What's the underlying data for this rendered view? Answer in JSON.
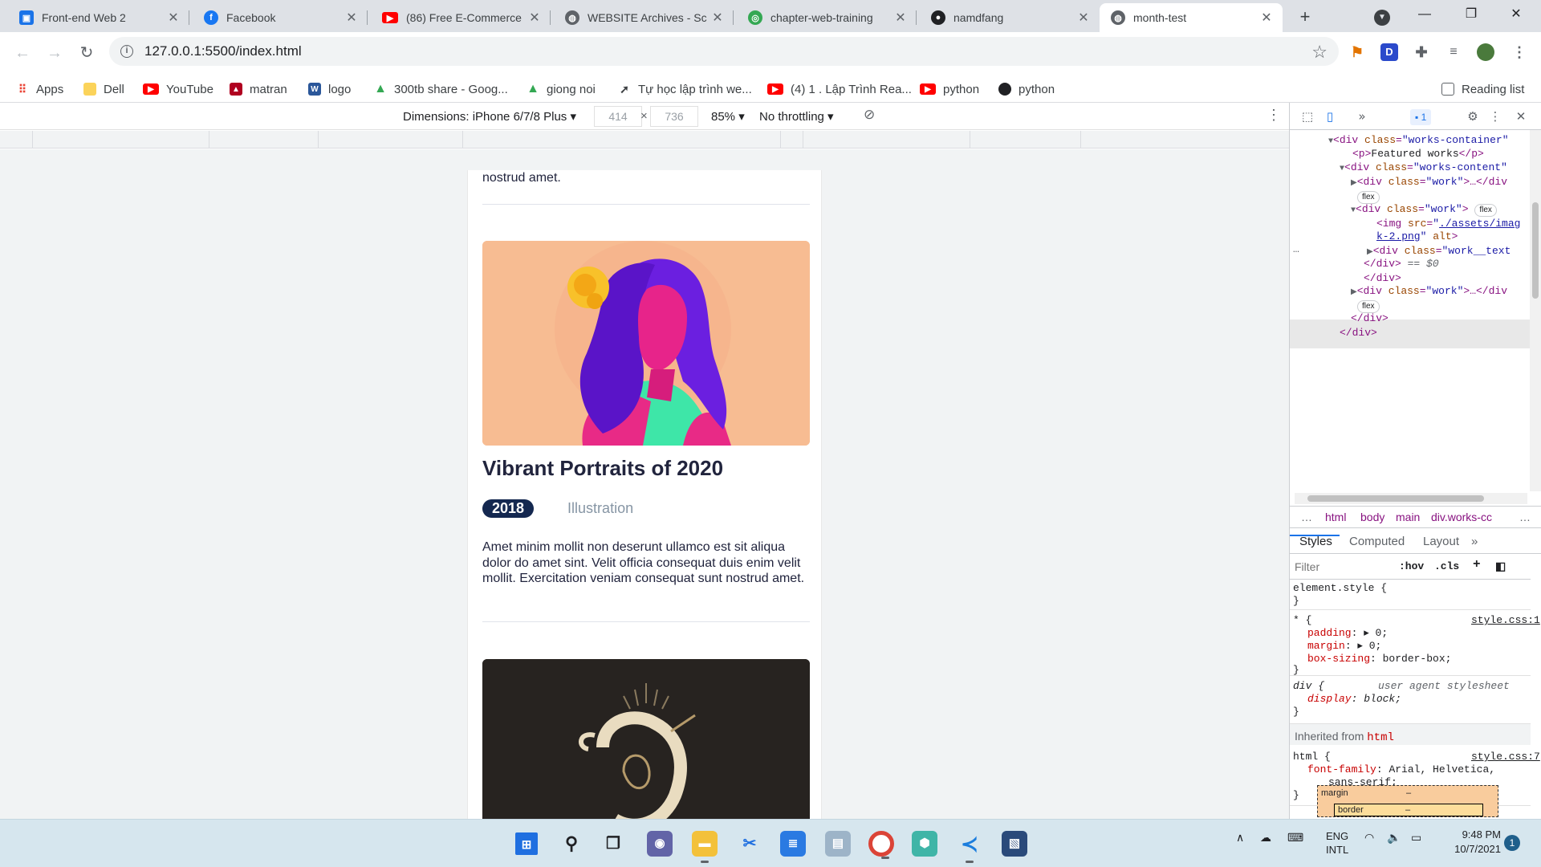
{
  "tabs": [
    {
      "title": "Front-end Web 2",
      "icon": "classroom-icon",
      "color": "#1a73e8"
    },
    {
      "title": "Facebook",
      "icon": "facebook-icon",
      "color": "#1877f2"
    },
    {
      "title": "(86) Free E-Commerce",
      "icon": "youtube-icon",
      "color": "#ff0000"
    },
    {
      "title": "WEBSITE Archives - Sc",
      "icon": "globe-icon",
      "color": "#5f6368"
    },
    {
      "title": "chapter-web-training",
      "icon": "chapter-icon",
      "color": "#34a853"
    },
    {
      "title": "namdfang",
      "icon": "github-icon",
      "color": "#202124"
    },
    {
      "title": "month-test",
      "icon": "globe-icon",
      "color": "#5f6368"
    }
  ],
  "address": {
    "url": "127.0.0.1:5500/index.html"
  },
  "bookmarks": [
    {
      "label": "Apps",
      "icon": "apps-grid-icon",
      "color": "#ea4335"
    },
    {
      "label": "Dell",
      "icon": "folder-icon",
      "color": "#fbbc04"
    },
    {
      "label": "YouTube",
      "icon": "youtube-icon",
      "color": "#ff0000"
    },
    {
      "label": "matran",
      "icon": "matran-icon",
      "color": "#b00020"
    },
    {
      "label": "logo",
      "icon": "word-icon",
      "color": "#2b579a"
    },
    {
      "label": "300tb share - Goog...",
      "icon": "drive-icon",
      "color": "#34a853"
    },
    {
      "label": "giong noi",
      "icon": "drive-icon",
      "color": "#34a853"
    },
    {
      "label": "Tự học lập trình we...",
      "icon": "bookmark-site-icon",
      "color": "#5f6368"
    },
    {
      "label": "(4) 1 . Lập Trình Rea...",
      "icon": "youtube-icon",
      "color": "#ff0000"
    },
    {
      "label": "python",
      "icon": "youtube-icon",
      "color": "#ff0000"
    },
    {
      "label": "python",
      "icon": "github-icon",
      "color": "#202124"
    }
  ],
  "reading_list": "Reading list",
  "device": {
    "dimensions": "Dimensions: iPhone 6/7/8 Plus",
    "width": "414",
    "height": "736",
    "zoom": "85%",
    "throttling": "No throttling"
  },
  "page": {
    "tail_text": "nostrud amet.",
    "work": {
      "title": "Vibrant Portraits of 2020",
      "year": "2018",
      "category": "Illustration",
      "description": "Amet minim mollit non deserunt ullamco est sit aliqua dolor do amet sint. Velit officia consequat duis enim velit mollit. Exercitation veniam consequat sunt nostrud amet."
    }
  },
  "devtools": {
    "issues_count": "1",
    "elements": {
      "works_container": "works-container",
      "featured_text": "Featured works",
      "works_content": "works-content",
      "work": "work",
      "flex": "flex",
      "img_src_a": "./assets/imag",
      "img_src_b": "k-2.png",
      "work_text": "work__text",
      "eq_label": "== $0"
    },
    "breadcrumbs": [
      "html",
      "body",
      "main",
      "div.works-cc"
    ],
    "panel_tabs": [
      "Styles",
      "Computed",
      "Layout"
    ],
    "filter_placeholder": "Filter",
    "hov": ":hov",
    "cls": ".cls",
    "styles": {
      "element_style": "element.style {",
      "universal_src": "style.css:1",
      "padding": "padding",
      "margin": "margin",
      "zero": "0;",
      "box_sizing": "box-sizing",
      "box_sizing_val": "border-box;",
      "div_ua": "user agent stylesheet",
      "display": "display",
      "display_val": "block;",
      "inherited_label": "Inherited from",
      "inherited_tag": "html",
      "html_src": "style.css:7",
      "font_family": "font-family",
      "font_family_val": "Arial, Helvetica,",
      "font_family_val2": "sans-serif;"
    },
    "boxmodel": {
      "margin": "margin",
      "border": "border",
      "dash": "–"
    }
  },
  "taskbar": {
    "language": "ENG",
    "layout": "INTL",
    "time": "9:48 PM",
    "date": "10/7/2021",
    "notifications": "1"
  }
}
